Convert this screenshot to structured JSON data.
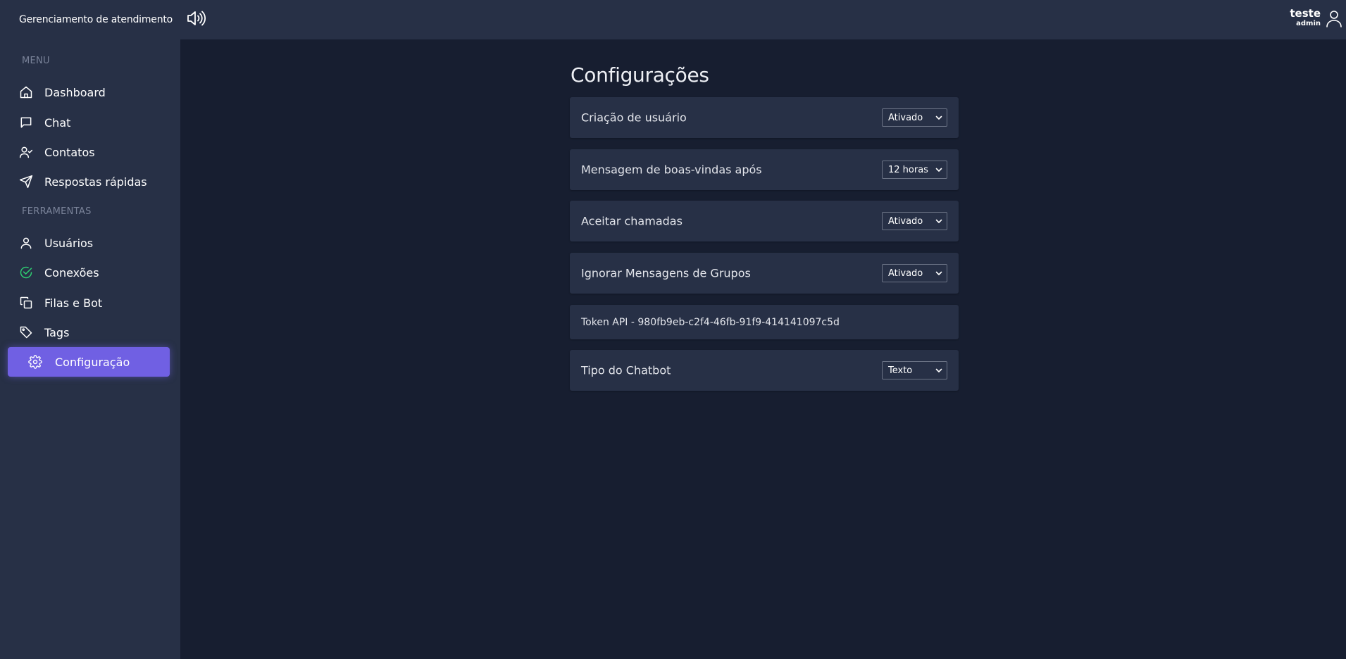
{
  "app": {
    "title": "Gerenciamento de atendimento"
  },
  "sidebar": {
    "menu_label": "MENU",
    "tools_label": "FERRAMENTAS",
    "menu_items": [
      {
        "label": "Dashboard",
        "icon": "home-icon"
      },
      {
        "label": "Chat",
        "icon": "chat-bubble-icon"
      },
      {
        "label": "Contatos",
        "icon": "user-check-icon"
      },
      {
        "label": "Respostas rápidas",
        "icon": "send-icon"
      }
    ],
    "tool_items": [
      {
        "label": "Usuários",
        "icon": "user-icon"
      },
      {
        "label": "Conexões",
        "icon": "check-circle-icon",
        "icon_color": "#2ecc71"
      },
      {
        "label": "Filas e Bot",
        "icon": "copy-icon"
      },
      {
        "label": "Tags",
        "icon": "tag-icon"
      },
      {
        "label": "Configuração",
        "icon": "gear-icon",
        "active": true
      }
    ]
  },
  "header": {
    "sound_icon": "speaker-icon",
    "user_name": "teste",
    "user_role": "admin",
    "user_icon": "user-icon"
  },
  "settings": {
    "title": "Configurações",
    "rows": [
      {
        "label": "Criação de usuário",
        "value": "Ativado"
      },
      {
        "label": "Mensagem de boas-vindas após",
        "value": "12 horas"
      },
      {
        "label": "Aceitar chamadas",
        "value": "Ativado"
      },
      {
        "label": "Ignorar Mensagens de Grupos",
        "value": "Ativado"
      },
      {
        "token": "Token API - 980fb9eb-c2f4-46fb-91f9-414141097c5d"
      },
      {
        "label": "Tipo do Chatbot",
        "value": "Texto"
      }
    ]
  },
  "colors": {
    "accent": "#7060e3",
    "sidebar_bg": "#273046",
    "content_bg": "#171e30",
    "success": "#2ecc71"
  }
}
